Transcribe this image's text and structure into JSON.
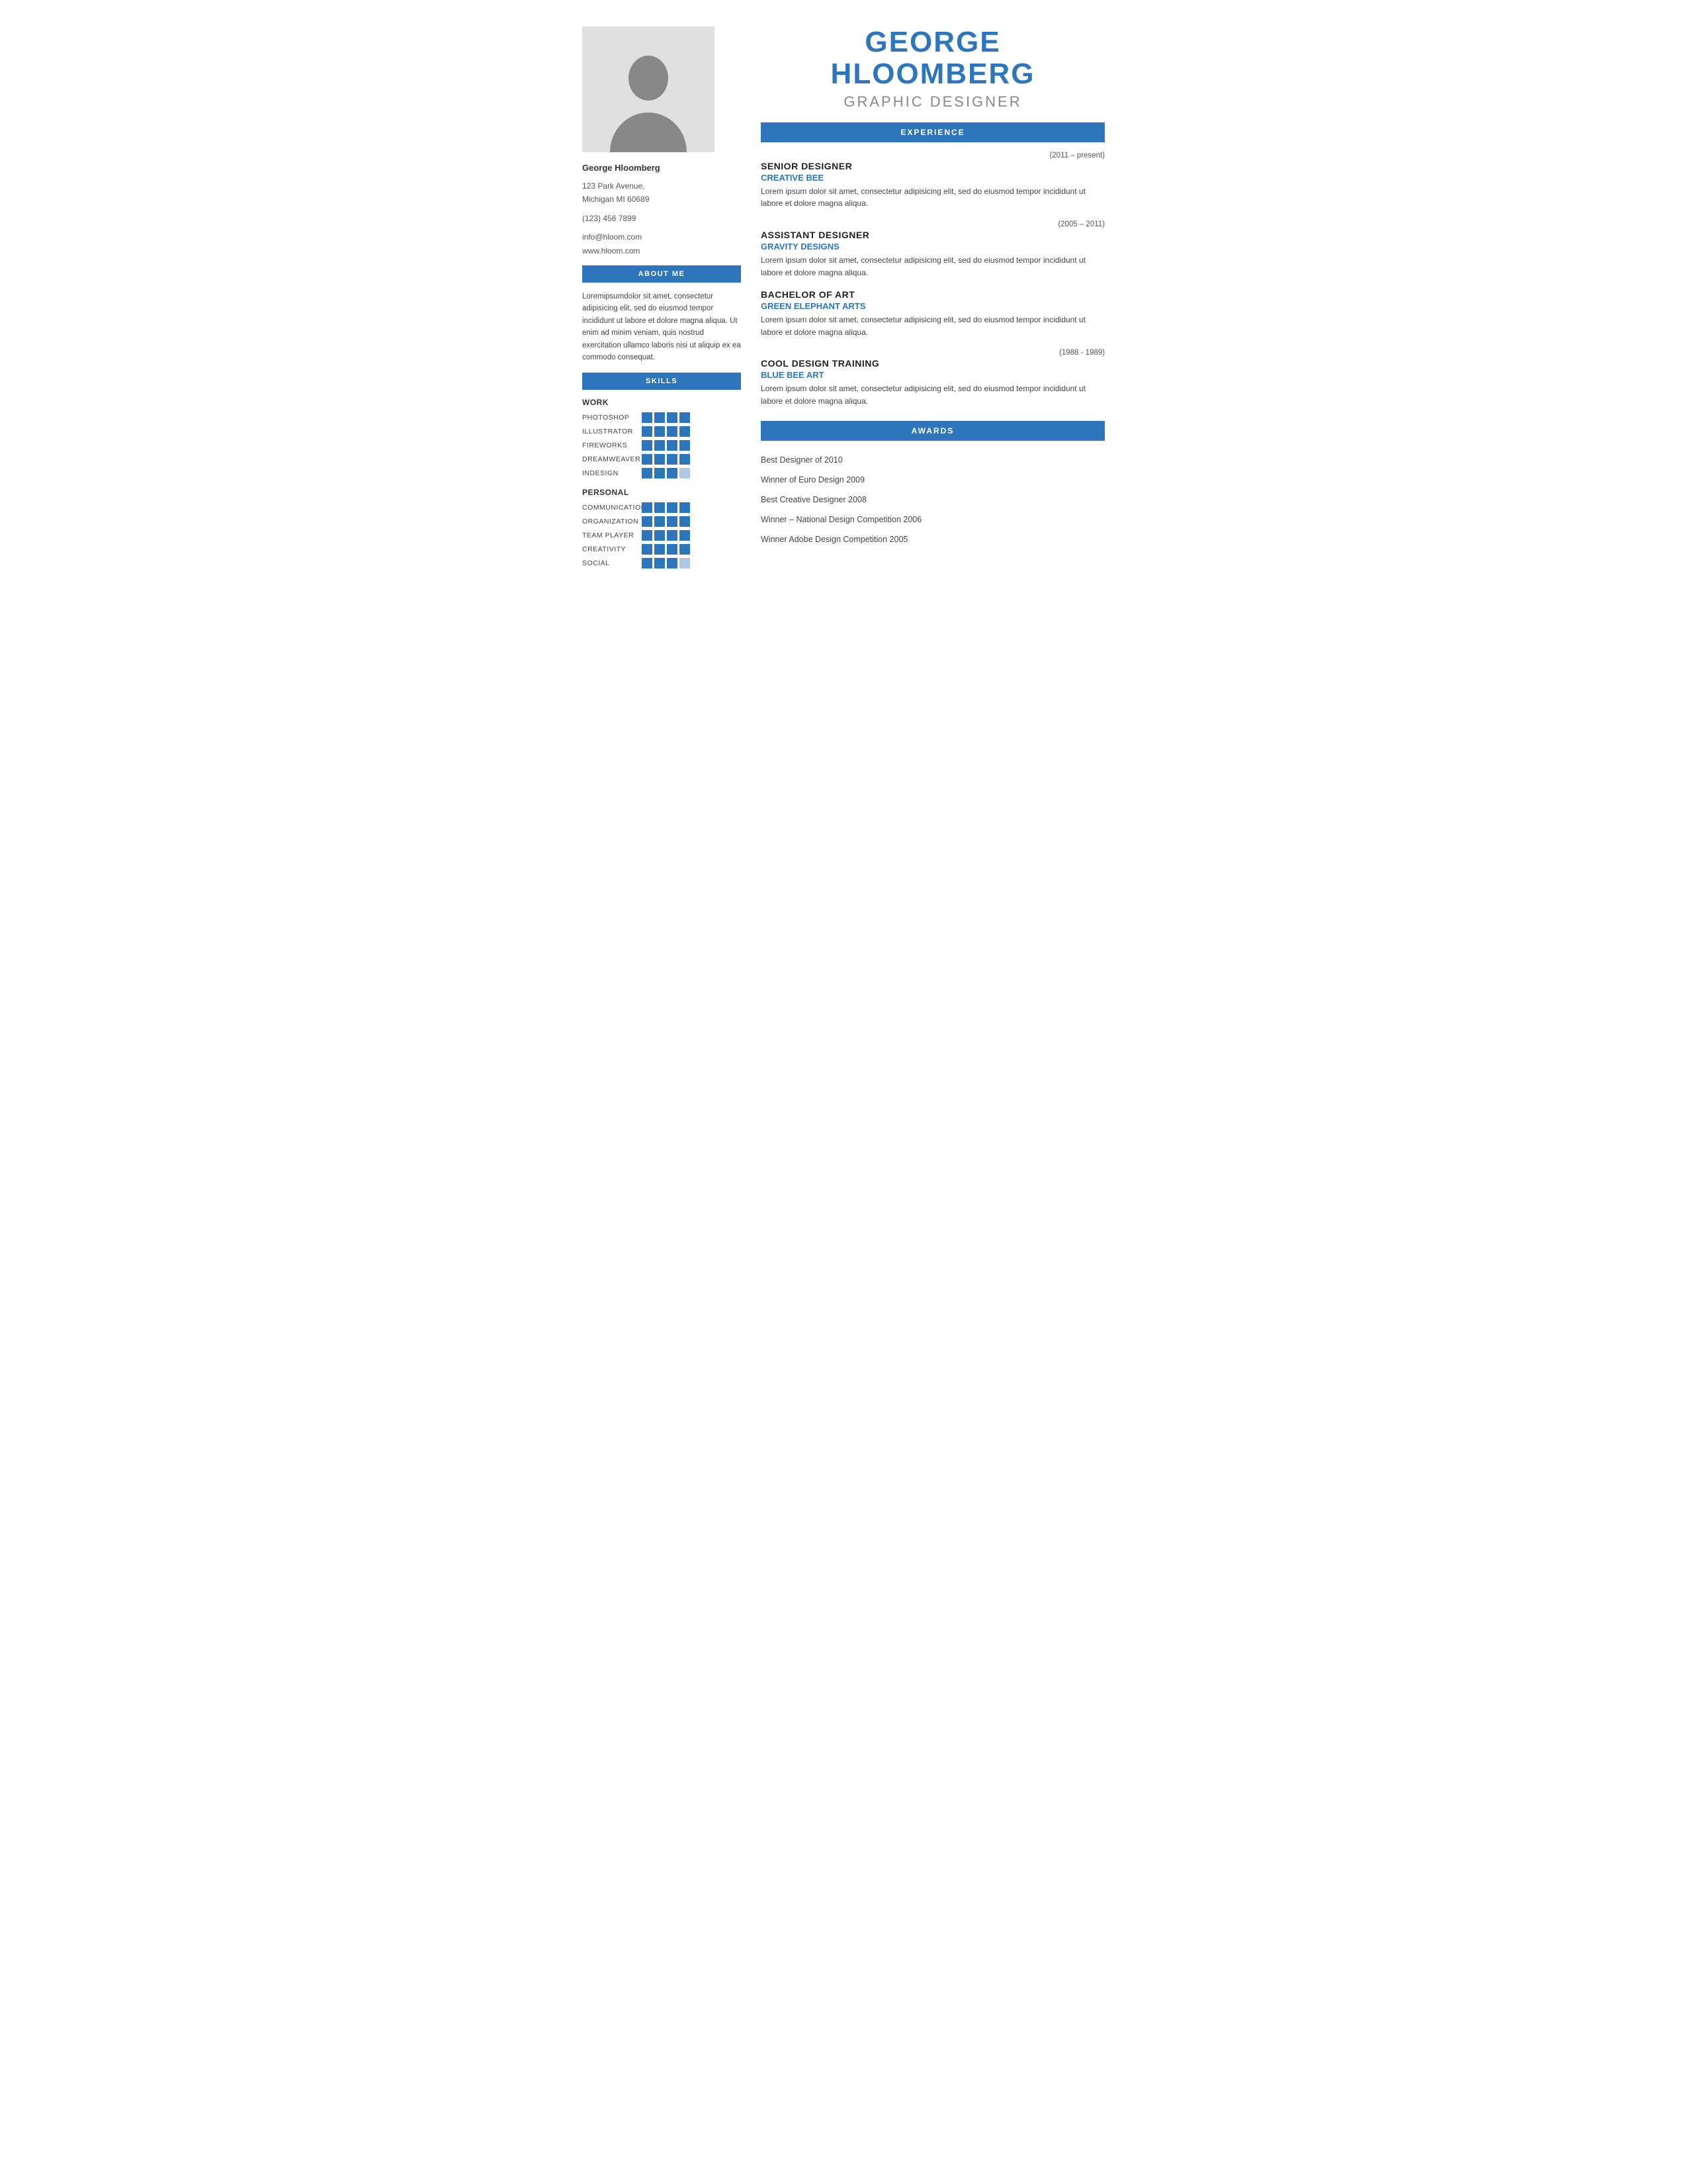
{
  "name": {
    "first": "GEORGE",
    "last": "HLOOMBERG",
    "title": "GRAPHIC DESIGNER",
    "display": "George Hloomberg"
  },
  "contact": {
    "address": "123 Park Avenue,",
    "city": "Michigan MI 60689",
    "phone": "(123) 456 7899",
    "email": "info@hloom.com",
    "website": "www.hloom.com"
  },
  "about": {
    "header": "ABOUT ME",
    "text": "Loremipsumdolor sit amet, consectetur adipisicing elit, sed do eiusmod tempor incididunt ut labore et dolore magna aliqua. Ut enim ad minim veniam, quis nostrud exercitation ullamco laboris nisi ut aliquip ex ea commodo consequat."
  },
  "skills": {
    "header": "SKILLS",
    "work_label": "WORK",
    "work_items": [
      {
        "name": "PHOTOSHOP",
        "filled": 4,
        "empty": 0
      },
      {
        "name": "ILLUSTRATOR",
        "filled": 4,
        "empty": 0
      },
      {
        "name": "FIREWORKS",
        "filled": 4,
        "empty": 0
      },
      {
        "name": "DREAMWEAVER",
        "filled": 4,
        "empty": 0
      },
      {
        "name": "INDESIGN",
        "filled": 3,
        "empty": 1
      }
    ],
    "personal_label": "PERSONAL",
    "personal_items": [
      {
        "name": "COMMUNICATION",
        "filled": 4,
        "empty": 0
      },
      {
        "name": "ORGANIZATION",
        "filled": 4,
        "empty": 0
      },
      {
        "name": "TEAM PLAYER",
        "filled": 4,
        "empty": 0
      },
      {
        "name": "CREATIVITY",
        "filled": 4,
        "empty": 0
      },
      {
        "name": "SOCIAL",
        "filled": 3,
        "empty": 1
      }
    ]
  },
  "experience": {
    "header": "EXPERIENCE",
    "items": [
      {
        "date": "(2011 – present)",
        "title": "SENIOR DESIGNER",
        "company": "CREATIVE BEE",
        "desc": "Lorem ipsum dolor sit amet, consectetur adipisicing elit, sed do eiusmod tempor incididunt ut labore et dolore magna aliqua."
      },
      {
        "date": "(2005 – 2011)",
        "title": "ASSISTANT DESIGNER",
        "company": "GRAVITY DESIGNS",
        "desc": "Lorem ipsum dolor sit amet, consectetur adipisicing elit, sed do eiusmod tempor incididunt ut labore et dolore magna aliqua."
      },
      {
        "date": "",
        "title": "BACHELOR OF ART",
        "company": "GREEN ELEPHANT ARTS",
        "desc": "Lorem ipsum dolor sit amet, consectetur adipisicing elit, sed do eiusmod tempor incididunt ut labore et dolore magna aliqua."
      },
      {
        "date": "(1988 - 1989)",
        "title": "COOL DESIGN TRAINING",
        "company": "BLUE BEE ART",
        "desc": "Lorem ipsum dolor sit amet, consectetur adipisicing elit, sed do eiusmod tempor incididunt ut labore et dolore magna aliqua."
      }
    ]
  },
  "awards": {
    "header": "AWARDS",
    "items": [
      "Best Designer of 2010",
      "Winner of Euro Design 2009",
      "Best Creative Designer 2008",
      "Winner – National Design Competition 2006",
      "Winner Adobe Design Competition 2005"
    ]
  }
}
